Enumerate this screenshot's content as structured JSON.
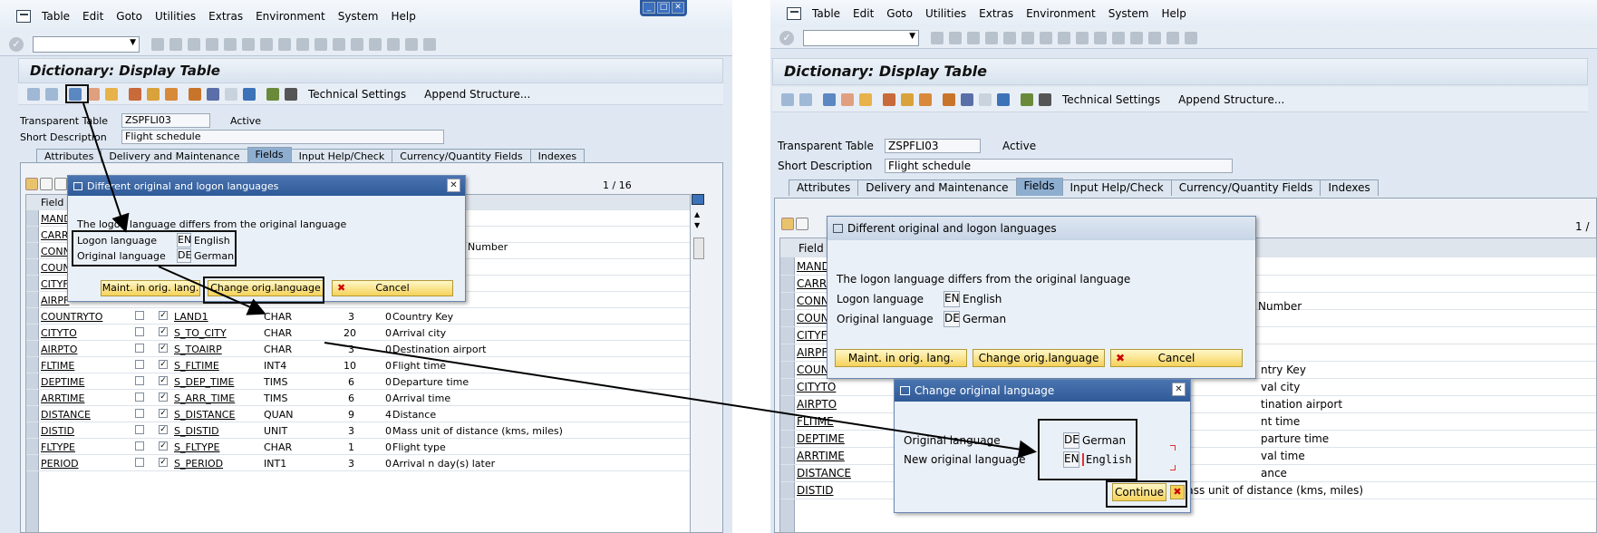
{
  "menu": [
    "Table",
    "Edit",
    "Goto",
    "Utilities",
    "Extras",
    "Environment",
    "System",
    "Help"
  ],
  "screen_title": "Dictionary: Display Table",
  "toolbar": {
    "technical_settings": "Technical Settings",
    "append_structure": "Append Structure..."
  },
  "header_fields": {
    "transparent_table_label": "Transparent Table",
    "table_name": "ZSPFLI03",
    "status": "Active",
    "short_description_label": "Short Description",
    "short_description": "Flight schedule"
  },
  "tabs": [
    "Attributes",
    "Delivery and Maintenance",
    "Fields",
    "Input Help/Check",
    "Currency/Quantity Fields",
    "Indexes"
  ],
  "pager": "1 / 16",
  "pager_right": "1 /",
  "field_col_header": "Field",
  "hidden_rows": [
    "MANDT",
    "CARRI",
    "CONNI",
    "COUNT",
    "CITYF",
    "AIRPF"
  ],
  "hidden_rows_right": [
    "MANDT",
    "CARRI",
    "CONNI",
    "COUNT",
    "CITYF",
    "AIRPF"
  ],
  "partial_desc": "Number",
  "rows": [
    {
      "field": "COUNTRYTO",
      "element": "LAND1",
      "type": "CHAR",
      "len": "3",
      "dec": "0",
      "desc": "Country Key"
    },
    {
      "field": "CITYTO",
      "element": "S_TO_CITY",
      "type": "CHAR",
      "len": "20",
      "dec": "0",
      "desc": "Arrival city"
    },
    {
      "field": "AIRPTO",
      "element": "S_TOAIRP",
      "type": "CHAR",
      "len": "3",
      "dec": "0",
      "desc": "Destination airport"
    },
    {
      "field": "FLTIME",
      "element": "S_FLTIME",
      "type": "INT4",
      "len": "10",
      "dec": "0",
      "desc": "Flight time"
    },
    {
      "field": "DEPTIME",
      "element": "S_DEP_TIME",
      "type": "TIMS",
      "len": "6",
      "dec": "0",
      "desc": "Departure time"
    },
    {
      "field": "ARRTIME",
      "element": "S_ARR_TIME",
      "type": "TIMS",
      "len": "6",
      "dec": "0",
      "desc": "Arrival time"
    },
    {
      "field": "DISTANCE",
      "element": "S_DISTANCE",
      "type": "QUAN",
      "len": "9",
      "dec": "4",
      "desc": "Distance"
    },
    {
      "field": "DISTID",
      "element": "S_DISTID",
      "type": "UNIT",
      "len": "3",
      "dec": "0",
      "desc": "Mass unit of distance (kms, miles)"
    },
    {
      "field": "FLTYPE",
      "element": "S_FLTYPE",
      "type": "CHAR",
      "len": "1",
      "dec": "0",
      "desc": "Flight type"
    },
    {
      "field": "PERIOD",
      "element": "S_PERIOD",
      "type": "INT1",
      "len": "3",
      "dec": "0",
      "desc": "Arrival n day(s) later"
    }
  ],
  "right_rows": [
    {
      "field": "COUNTRYTO",
      "desc": "ntry Key"
    },
    {
      "field": "CITYTO",
      "desc": "val city"
    },
    {
      "field": "AIRPTO",
      "desc": "tination airport"
    },
    {
      "field": "FLTIME",
      "desc": "nt time"
    },
    {
      "field": "DEPTIME",
      "desc": "parture time"
    },
    {
      "field": "ARRTIME",
      "desc": "val time"
    },
    {
      "field": "DISTANCE",
      "desc": "ance"
    },
    {
      "field": "DISTID",
      "element": "S_DISTID",
      "type": "UNIT",
      "len": "3",
      "dec": "0",
      "desc": "Mass unit of distance (kms, miles)"
    }
  ],
  "dialog1": {
    "title": "Different original and logon languages",
    "message": "The logon language differs from the original language",
    "logon_label": "Logon language",
    "logon_code": "EN",
    "logon_lang": "English",
    "orig_label": "Original language",
    "orig_code": "DE",
    "orig_lang": "German",
    "btn_maint": "Maint. in orig. lang.",
    "btn_change": "Change orig.language",
    "btn_cancel": "Cancel"
  },
  "dialog2": {
    "title": "Change original language",
    "orig_label": "Original language",
    "orig_code": "DE",
    "orig_lang": "German",
    "new_label": "New original language",
    "new_code": "EN",
    "new_lang": "English",
    "btn_continue": "Continue"
  }
}
